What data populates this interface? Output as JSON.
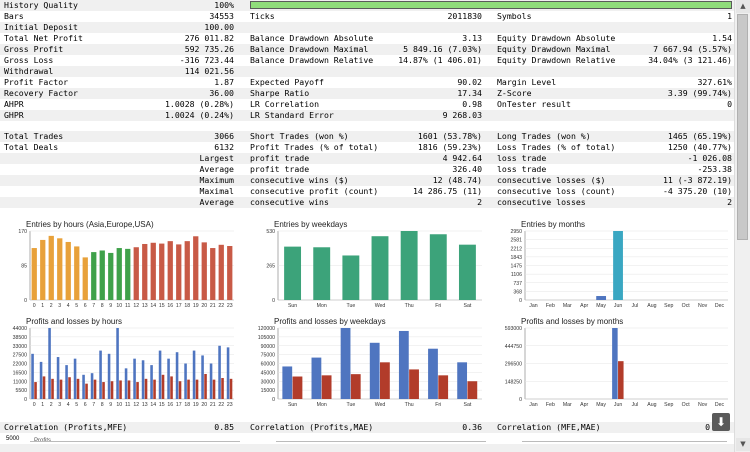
{
  "report": {
    "history_quality": {
      "label": "History Quality",
      "value": "100%"
    },
    "bars": {
      "label": "Bars",
      "value": "34553"
    },
    "ticks": {
      "label": "Ticks",
      "value": "2011830"
    },
    "symbols": {
      "label": "Symbols",
      "value": "1"
    },
    "initial_deposit": {
      "label": "Initial Deposit",
      "value": "100.00"
    },
    "total_net_profit": {
      "label": "Total Net Profit",
      "value": "276 011.82"
    },
    "bal_dd_abs": {
      "label": "Balance Drawdown Absolute",
      "value": "3.13"
    },
    "eq_dd_abs": {
      "label": "Equity Drawdown Absolute",
      "value": "1.54"
    },
    "gross_profit": {
      "label": "Gross Profit",
      "value": "592 735.26"
    },
    "bal_dd_max": {
      "label": "Balance Drawdown Maximal",
      "value": "5 849.16 (7.03%)"
    },
    "eq_dd_max": {
      "label": "Equity Drawdown Maximal",
      "value": "7 667.94 (5.57%)"
    },
    "gross_loss": {
      "label": "Gross Loss",
      "value": "-316 723.44"
    },
    "bal_dd_rel": {
      "label": "Balance Drawdown Relative",
      "value": "14.87% (1 406.01)"
    },
    "eq_dd_rel": {
      "label": "Equity Drawdown Relative",
      "value": "34.04% (3 121.46)"
    },
    "withdrawal": {
      "label": "Withdrawal",
      "value": "114 021.56"
    },
    "profit_factor": {
      "label": "Profit Factor",
      "value": "1.87"
    },
    "expected_payoff": {
      "label": "Expected Payoff",
      "value": "90.02"
    },
    "margin_level": {
      "label": "Margin Level",
      "value": "327.61%"
    },
    "recovery_factor": {
      "label": "Recovery Factor",
      "value": "36.00"
    },
    "sharpe_ratio": {
      "label": "Sharpe Ratio",
      "value": "17.34"
    },
    "z_score": {
      "label": "Z-Score",
      "value": "3.39 (99.74%)"
    },
    "ahpr": {
      "label": "AHPR",
      "value": "1.0028 (0.28%)"
    },
    "lr_correlation": {
      "label": "LR Correlation",
      "value": "0.98"
    },
    "ontester": {
      "label": "OnTester result",
      "value": "0"
    },
    "ghpr": {
      "label": "GHPR",
      "value": "1.0024 (0.24%)"
    },
    "lr_std_error": {
      "label": "LR Standard Error",
      "value": "9 268.03"
    },
    "total_trades": {
      "label": "Total Trades",
      "value": "3066"
    },
    "short_trades": {
      "label": "Short Trades (won %)",
      "value": "1601 (53.78%)"
    },
    "long_trades": {
      "label": "Long Trades (won %)",
      "value": "1465 (65.19%)"
    },
    "total_deals": {
      "label": "Total Deals",
      "value": "6132"
    },
    "profit_trades": {
      "label": "Profit Trades (% of total)",
      "value": "1816 (59.23%)"
    },
    "loss_trades": {
      "label": "Loss Trades (% of total)",
      "value": "1250 (40.77%)"
    },
    "largest": {
      "label": "Largest",
      "p_label": "profit trade",
      "p_value": "4 942.64",
      "l_label": "loss trade",
      "l_value": "-1 026.08"
    },
    "average": {
      "label": "Average",
      "p_label": "profit trade",
      "p_value": "326.40",
      "l_label": "loss trade",
      "l_value": "-253.38"
    },
    "maximum": {
      "label": "Maximum",
      "p_label": "consecutive wins ($)",
      "p_value": "12 (48.74)",
      "l_label": "consecutive losses ($)",
      "l_value": "11 (-3 872.19)"
    },
    "maximal": {
      "label": "Maximal",
      "p_label": "consecutive profit (count)",
      "p_value": "14 286.75 (11)",
      "l_label": "consecutive loss (count)",
      "l_value": "-4 375.20 (10)"
    },
    "average2": {
      "label": "Average",
      "p_label": "consecutive wins",
      "p_value": "2",
      "l_label": "consecutive losses",
      "l_value": "2"
    },
    "corr_mfe": {
      "label": "Correlation (Profits,MFE)",
      "value": "0.85"
    },
    "corr_mae": {
      "label": "Correlation (Profits,MAE)",
      "value": "0.36"
    },
    "corr_mfe_mae": {
      "label": "Correlation (MFE,MAE)",
      "value": "0"
    },
    "bottom_axis": {
      "value": "5000"
    },
    "bottom_title": {
      "value": "Profits"
    }
  },
  "colors": {
    "orange": "#e8a13a",
    "green": "#3fa14a",
    "red": "#c85a46",
    "teal": "#3ca37a",
    "blue": "#4f75c0",
    "darkred": "#b23c2a",
    "cyan": "#3aa7c2"
  },
  "chart_data": [
    {
      "type": "bar",
      "title": "Entries by hours (Asia,Europe,USA)",
      "categories": [
        "0",
        "1",
        "2",
        "3",
        "4",
        "5",
        "6",
        "7",
        "8",
        "9",
        "10",
        "11",
        "12",
        "13",
        "14",
        "15",
        "16",
        "17",
        "18",
        "19",
        "20",
        "21",
        "22",
        "23"
      ],
      "values": [
        128,
        148,
        158,
        152,
        143,
        132,
        105,
        118,
        122,
        116,
        128,
        126,
        130,
        138,
        141,
        139,
        145,
        137,
        145,
        157,
        142,
        128,
        136,
        133
      ],
      "ylim": [
        0,
        170
      ],
      "yticks": [
        "170",
        "85",
        "0"
      ]
    },
    {
      "type": "bar",
      "title": "Entries by weekdays",
      "categories": [
        "Sun",
        "Mon",
        "Tue",
        "Wed",
        "Thu",
        "Fri",
        "Sat"
      ],
      "values": [
        410,
        405,
        342,
        490,
        530,
        505,
        425
      ],
      "ylim": [
        0,
        530
      ],
      "yticks": [
        "530",
        "265",
        "0"
      ]
    },
    {
      "type": "bar",
      "title": "Entries by months",
      "categories": [
        "Jan",
        "Feb",
        "Mar",
        "Apr",
        "May",
        "Jun",
        "Jul",
        "Aug",
        "Sep",
        "Oct",
        "Nov",
        "Dec"
      ],
      "values": [
        0,
        0,
        0,
        0,
        170,
        2950,
        0,
        0,
        0,
        0,
        0,
        0
      ],
      "ylim": [
        0,
        2950
      ],
      "yticks": [
        "2950",
        "2581",
        "2212",
        "1843",
        "1475",
        "1106",
        "737",
        "368",
        "0"
      ]
    },
    {
      "type": "bar",
      "title": "Profits and losses by hours",
      "categories": [
        "0",
        "1",
        "2",
        "3",
        "4",
        "5",
        "6",
        "7",
        "8",
        "9",
        "10",
        "11",
        "12",
        "13",
        "14",
        "15",
        "16",
        "17",
        "18",
        "19",
        "20",
        "21",
        "22",
        "23"
      ],
      "series": [
        {
          "values": [
            28000,
            23000,
            44000,
            26000,
            21000,
            25000,
            15000,
            16000,
            30000,
            28000,
            44000,
            19000,
            25000,
            24000,
            21000,
            30000,
            25000,
            29000,
            22000,
            30000,
            27000,
            22000,
            33000,
            32000
          ]
        },
        {
          "values": [
            10500,
            14000,
            12500,
            12000,
            13500,
            12500,
            9500,
            12000,
            10500,
            11000,
            11500,
            11500,
            10500,
            12500,
            12000,
            15000,
            14000,
            11000,
            12000,
            12000,
            15500,
            12000,
            13000,
            12500
          ]
        }
      ],
      "ylim": [
        0,
        44000
      ],
      "yticks": [
        "44000",
        "38500",
        "33000",
        "27500",
        "22000",
        "16500",
        "11000",
        "5500",
        "0"
      ]
    },
    {
      "type": "bar",
      "title": "Profits and losses by weekdays",
      "categories": [
        "Sun",
        "Mon",
        "Tue",
        "Wed",
        "Thu",
        "Fri",
        "Sat"
      ],
      "series": [
        {
          "values": [
            55000,
            70000,
            120000,
            95000,
            115000,
            85000,
            62000
          ]
        },
        {
          "values": [
            38000,
            40000,
            42000,
            62000,
            50000,
            40000,
            30000
          ]
        }
      ],
      "ylim": [
        0,
        120000
      ],
      "yticks": [
        "120000",
        "105000",
        "90000",
        "75000",
        "60000",
        "45000",
        "30000",
        "15000",
        "0"
      ]
    },
    {
      "type": "bar",
      "title": "Profits and losses by months",
      "categories": [
        "Jan",
        "Feb",
        "Mar",
        "Apr",
        "May",
        "Jun",
        "Jul",
        "Aug",
        "Sep",
        "Oct",
        "Nov",
        "Dec"
      ],
      "series": [
        {
          "values": [
            0,
            0,
            0,
            0,
            0,
            593000,
            0,
            0,
            0,
            0,
            0,
            0
          ]
        },
        {
          "values": [
            0,
            0,
            0,
            0,
            0,
            316000,
            0,
            0,
            0,
            0,
            0,
            0
          ]
        }
      ],
      "ylim": [
        0,
        593000
      ],
      "yticks": [
        "593000",
        "444750",
        "296500",
        "148250",
        "0"
      ]
    }
  ]
}
